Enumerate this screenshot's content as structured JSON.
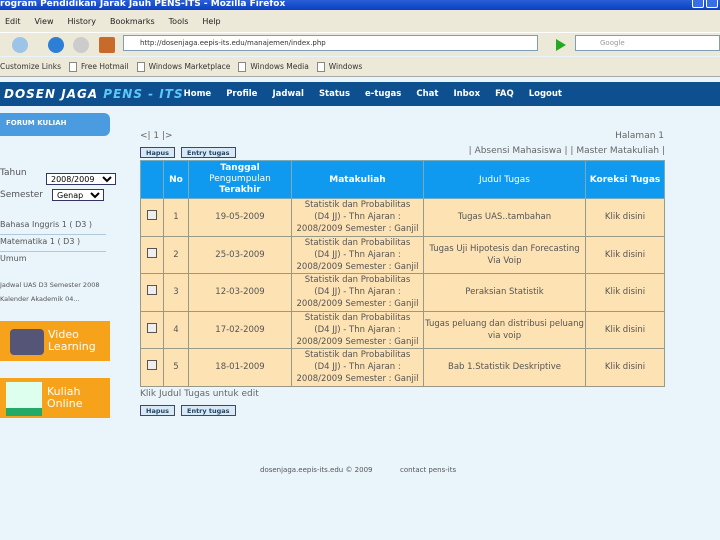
{
  "browser": {
    "title": "rogram Pendidikan Jarak Jauh PENS-ITS - Mozilla Firefox",
    "menu": [
      "Edit",
      "View",
      "History",
      "Bookmarks",
      "Tools",
      "Help"
    ],
    "url": "http://dosenjaga.eepis-its.edu/manajemen/index.php",
    "search_placeholder": "Google",
    "bookmarks": [
      "Customize Links",
      "Free Hotmail",
      "Windows Marketplace",
      "Windows Media",
      "Windows"
    ]
  },
  "site": {
    "logo_a": "DOSEN JAGA ",
    "logo_b": "PENS - ITS",
    "nav": [
      "Home",
      "Profile",
      "Jadwal",
      "Status",
      "e-tugas",
      "Chat",
      "Inbox",
      "FAQ",
      "Logout"
    ]
  },
  "sidebar": {
    "forum": "FORUM KULIAH",
    "tahun_label": "Tahun",
    "tahun_value": "2008/2009",
    "semester_label": "Semester",
    "semester_value": "Genap",
    "links": [
      "Bahasa Inggris 1 ( D3 )",
      "Matematika 1 ( D3 )",
      "Umum"
    ],
    "small": [
      "Jadwal UAS D3 Semester 2008",
      "Kalender Akademik 04..."
    ],
    "promo1": [
      "Video",
      "Learning"
    ],
    "promo2": [
      "Kuliah",
      "Online"
    ]
  },
  "main": {
    "pager": "<| 1 |>",
    "page_label": "Halaman 1",
    "hapus": "Hapus",
    "entry": "Entry tugas",
    "links": "| Absensi Mahasiswa | | Master Matakuliah |",
    "headers": [
      "No",
      "Tanggal",
      "Pengumpulan",
      "Terakhir",
      "Matakuliah",
      "Judul Tugas",
      "Koreksi Tugas"
    ],
    "rows": [
      {
        "no": "1",
        "date": "19-05-2009",
        "mk": [
          "Statistik dan Probabilitas",
          "(D4 JJ) - Thn Ajaran :",
          "2008/2009 Semester : Ganjil"
        ],
        "judul": "Tugas UAS..tambahan",
        "koreksi": "Klik disini"
      },
      {
        "no": "2",
        "date": "25-03-2009",
        "mk": [
          "Statistik dan Probabilitas",
          "(D4 JJ) - Thn Ajaran :",
          "2008/2009 Semester : Ganjil"
        ],
        "judul": "Tugas Uji Hipotesis dan Forecasting Via Voip",
        "koreksi": "Klik disini"
      },
      {
        "no": "3",
        "date": "12-03-2009",
        "mk": [
          "Statistik dan Probabilitas",
          "(D4 JJ) - Thn Ajaran :",
          "2008/2009 Semester : Ganjil"
        ],
        "judul": "Peraksian Statistik",
        "koreksi": "Klik disini"
      },
      {
        "no": "4",
        "date": "17-02-2009",
        "mk": [
          "Statistik dan Probabilitas",
          "(D4 JJ) - Thn Ajaran :",
          "2008/2009 Semester : Ganjil"
        ],
        "judul": "Tugas peluang dan distribusi peluang via voip",
        "koreksi": "Klik disini"
      },
      {
        "no": "5",
        "date": "18-01-2009",
        "mk": [
          "Statistik dan Probabilitas",
          "(D4 JJ) - Thn Ajaran :",
          "2008/2009 Semester : Ganjil"
        ],
        "judul": "Bab 1.Statistik Deskriptive",
        "koreksi": "Klik disini"
      }
    ],
    "hint": "Klik Judul Tugas untuk edit"
  },
  "footer": {
    "copyright": "dosenjaga.eepis-its.edu © 2009",
    "contact": "contact pens-its"
  }
}
